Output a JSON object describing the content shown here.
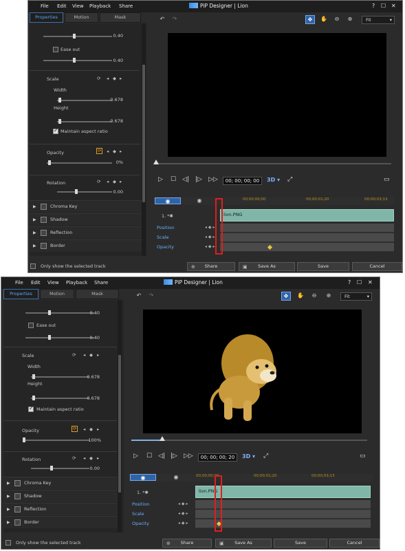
{
  "app": {
    "title": "PiP Designer | Lion",
    "menu": [
      "File",
      "Edit",
      "View",
      "Playback",
      "Share"
    ],
    "window_buttons": [
      "?",
      "☐",
      "✕"
    ]
  },
  "tabs": [
    "Properties",
    "Motion",
    "Mask"
  ],
  "fade": {
    "value_top": "0.40",
    "ease_out_label": "Ease out",
    "value_bottom": "0.40"
  },
  "scale": {
    "label": "Scale",
    "width_label": "Width",
    "height_label": "Height",
    "width_value": "0.678",
    "height_value": "0.678",
    "maintain_label": "Maintain aspect ratio"
  },
  "opacity": {
    "label": "Opacity"
  },
  "rotation": {
    "label": "Rotation",
    "value": "0.00"
  },
  "accordion": [
    "Chroma Key",
    "Shadow",
    "Reflection",
    "Border"
  ],
  "footer": {
    "only_selected": "Only show the selected track"
  },
  "toolbar": {
    "zoom_select": "Fit"
  },
  "timeline": {
    "rulers": [
      "00;00;00;00",
      "00;00;01;20",
      "00;00;03;13"
    ],
    "track_label": "1. *✱",
    "clip_name": "lion.PNG",
    "rows": [
      "Position",
      "Scale",
      "Opacity"
    ]
  },
  "buttons": {
    "share": "Share",
    "save_as": "Save As",
    "save": "Save",
    "cancel": "Cancel"
  },
  "screens": [
    {
      "timecode": "00; 00; 00; 00",
      "opacity_value": "0%",
      "scrub_fraction": 0.0
    },
    {
      "timecode": "00; 00; 00; 20",
      "opacity_value": "100%",
      "scrub_fraction": 0.12
    }
  ]
}
